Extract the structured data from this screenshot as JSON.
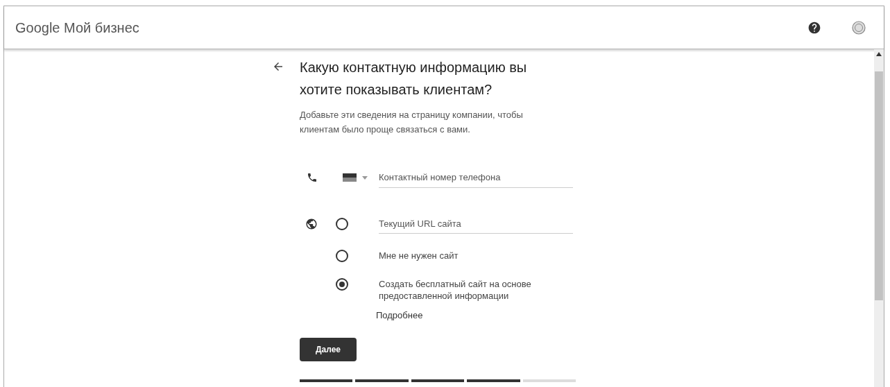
{
  "header": {
    "logo": "Google",
    "product": "Мой бизнес"
  },
  "title": "Какую контактную информацию вы хотите показывать клиентам?",
  "subtitle": "Добавьте эти сведения на страницу компании, чтобы клиентам было проще связаться с вами.",
  "phone": {
    "placeholder": "Контактный номер телефона"
  },
  "website": {
    "url_placeholder": "Текущий URL сайта",
    "options": [
      {
        "kind": "field",
        "selected": false
      },
      {
        "kind": "text",
        "label": "Мне не нужен сайт",
        "selected": false
      },
      {
        "kind": "text",
        "label": "Создать бесплатный сайт на основе предоставленной информации",
        "selected": true
      }
    ]
  },
  "more_link": "Подробнее",
  "next_button": "Далее",
  "progress": [
    {
      "done": true
    },
    {
      "done": true
    },
    {
      "done": true
    },
    {
      "done": true
    },
    {
      "done": false
    }
  ]
}
